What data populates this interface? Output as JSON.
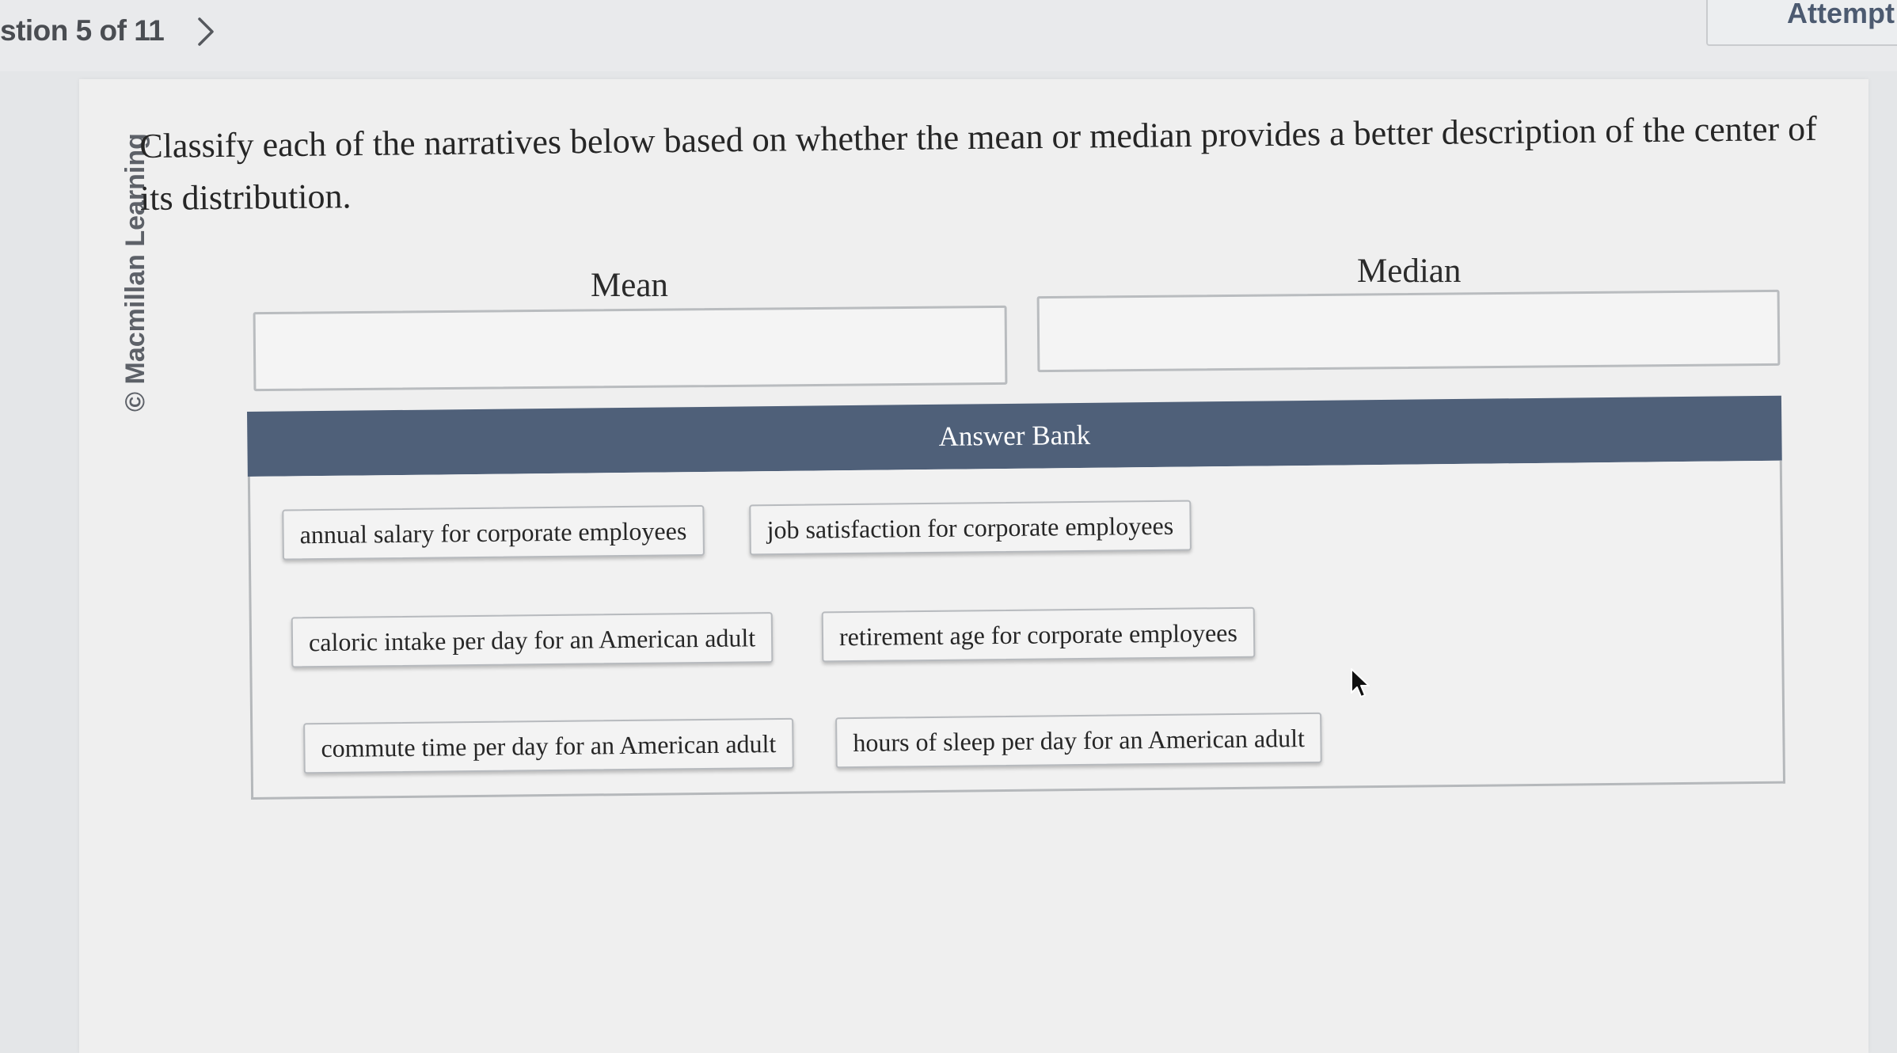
{
  "header": {
    "question_counter": "stion 5 of 11",
    "attempt_label": "Attempt"
  },
  "side_credit": "© Macmillan Learning",
  "question": {
    "prompt": "Classify each of the narratives below based on whether the mean or median provides a better description of the center of its distribution."
  },
  "categories": [
    {
      "label": "Mean"
    },
    {
      "label": "Median"
    }
  ],
  "answer_bank": {
    "title": "Answer Bank",
    "items": [
      "annual salary for corporate employees",
      "job satisfaction for corporate employees",
      "caloric intake per day for an American adult",
      "retirement age for corporate employees",
      "commute time per day for an American adult",
      "hours of sleep per day for an American adult"
    ]
  },
  "colors": {
    "bank_header": "#4f6079",
    "attempt_text": "#4c5a70"
  },
  "icons": {
    "next": "chevron-right-icon",
    "cursor": "mouse-pointer-icon"
  }
}
